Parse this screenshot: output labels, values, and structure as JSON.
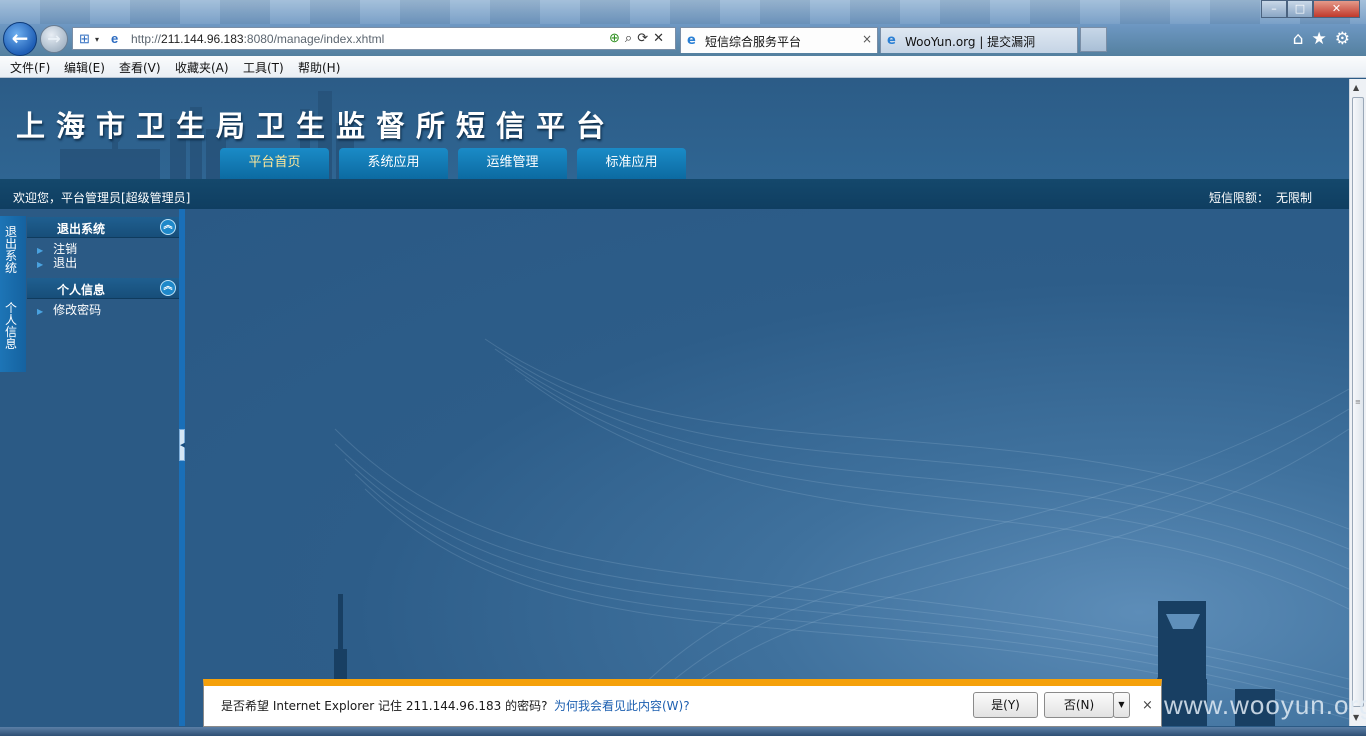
{
  "browser": {
    "url_prefix": "http://",
    "url_host": "211.144.96.183",
    "url_rest": ":8080/manage/index.xhtml",
    "tabs": [
      {
        "title": "短信综合服务平台",
        "close": "×"
      },
      {
        "title": "WooYun.org | 提交漏洞"
      }
    ],
    "window_controls": {
      "minimize": "–",
      "maximize": "□",
      "close": "✕"
    },
    "address_tools": "⟲ ✕"
  },
  "menubar": {
    "items": [
      "文件(F)",
      "编辑(E)",
      "查看(V)",
      "收藏夹(A)",
      "工具(T)",
      "帮助(H)"
    ]
  },
  "header": {
    "title": "上海市卫生局卫生监督所短信平台",
    "nav": [
      "平台首页",
      "系统应用",
      "运维管理",
      "标准应用"
    ]
  },
  "infobar": {
    "welcome": "欢迎您，平台管理员[超级管理员]",
    "sms_limit_label": "短信限额：",
    "sms_limit_value": "无限制"
  },
  "side_tabs": [
    "退出系统",
    "个人信息"
  ],
  "sidebar": {
    "panels": [
      {
        "title": "退出系统",
        "items": [
          "注销",
          "退出"
        ]
      },
      {
        "title": "个人信息",
        "items": [
          "修改密码"
        ]
      }
    ]
  },
  "notification": {
    "message": "是否希望 Internet Explorer 记住 211.144.96.183 的密码?",
    "link": "为何我会看见此内容(W)?",
    "yes": "是(Y)",
    "no": "否(N)",
    "close": "×"
  },
  "watermark": "www.wooyun.org",
  "colors": {
    "page_bg": "#2b5a85",
    "nav_tab": "#0f78b5",
    "nav_home_text": "#ffe89a",
    "infobar": "#133f60",
    "notify_accent": "#f5a10b"
  },
  "icons": [
    "back-arrow-icon",
    "forward-arrow-icon",
    "compat-view-icon",
    "ie-page-icon",
    "search-icon",
    "refresh-icon",
    "stop-icon",
    "home-icon",
    "favorites-star-icon",
    "tools-gear-icon"
  ]
}
